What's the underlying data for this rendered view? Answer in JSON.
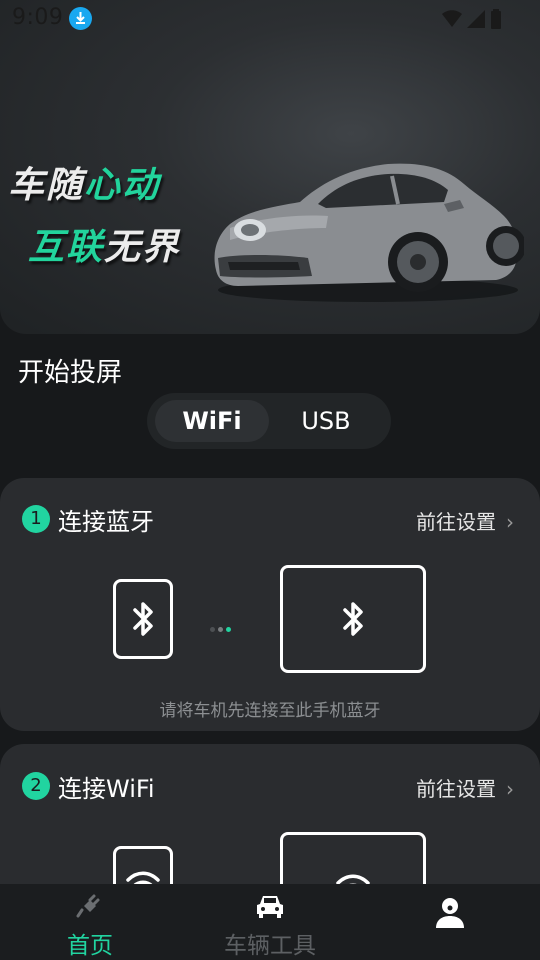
{
  "status_bar": {
    "time": "9:09",
    "icons": [
      "download-icon",
      "wifi-icon",
      "signal-icon",
      "battery-icon"
    ]
  },
  "banner": {
    "slogan_line1_part1": "车随",
    "slogan_line1_part2": "心动",
    "slogan_line2_part1": "互联",
    "slogan_line2_part2": "无界",
    "accent_color": "#22d49c"
  },
  "section": {
    "title": "开始投屏"
  },
  "connection_mode": {
    "options": [
      "WiFi",
      "USB"
    ],
    "selected": "WiFi"
  },
  "cards": [
    {
      "step": "1",
      "title": "连接蓝牙",
      "link": "前往设置",
      "icon": "bluetooth-icon",
      "hint": "请将车机先连接至此手机蓝牙"
    },
    {
      "step": "2",
      "title": "连接WiFi",
      "link": "前往设置",
      "icon": "wifi-icon"
    }
  ],
  "bottom_nav": {
    "items": [
      {
        "label": "首页",
        "icon": "plug-icon",
        "active": true
      },
      {
        "label": "车辆工具",
        "icon": "car-icon",
        "active": false
      },
      {
        "label": "",
        "icon": "profile-icon",
        "active": false
      }
    ],
    "active_color": "#21d4a0"
  }
}
